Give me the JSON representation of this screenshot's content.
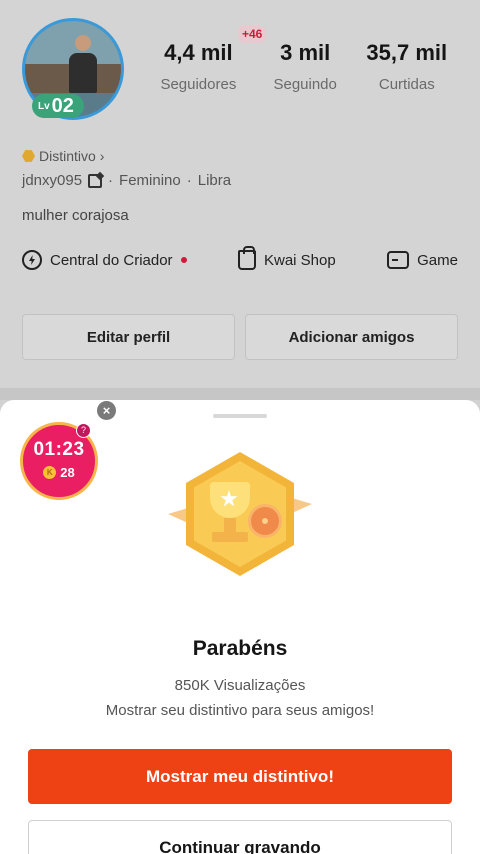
{
  "profile": {
    "level_prefix": "Lv",
    "level": "02",
    "stats": [
      {
        "value": "4,4 mil",
        "label": "Seguidores",
        "badge": "+46"
      },
      {
        "value": "3 mil",
        "label": "Seguindo"
      },
      {
        "value": "35,7 mil",
        "label": "Curtidas"
      }
    ],
    "distintivo_label": "Distintivo",
    "distintivo_chevron": "›",
    "username": "jdnxy095",
    "gender": "Feminino",
    "sign": "Libra",
    "separator": "·",
    "bio": "mulher  corajosa",
    "links": [
      {
        "label": "Central do Criador",
        "icon": "creator-center-icon"
      },
      {
        "label": "Kwai Shop",
        "icon": "shopping-bag-icon"
      },
      {
        "label": "Game",
        "icon": "game-controller-icon"
      }
    ],
    "edit_profile_label": "Editar perfil",
    "add_friends_label": "Adicionar amigos"
  },
  "sheet": {
    "title": "Parabéns",
    "subtitle": "850K Visualizações",
    "description": "Mostrar seu distintivo para seus amigos!",
    "primary_button": "Mostrar meu distintivo!",
    "secondary_button": "Continuar gravando"
  },
  "timer": {
    "time": "01:23",
    "coins": "28",
    "coin_symbol": "K",
    "help": "?",
    "close": "×"
  },
  "colors": {
    "primary": "#ee4214",
    "timer_bg": "#e91e63",
    "badge_gold": "#f2b53a",
    "level_green": "#3aa37a"
  }
}
